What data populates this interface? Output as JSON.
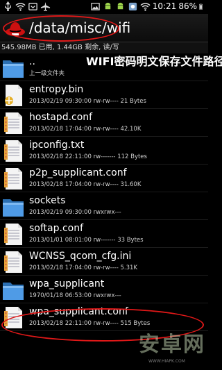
{
  "status_bar": {
    "time": "10:21",
    "battery": "86%",
    "icons_left": [
      "usb-icon",
      "wifi-icon",
      "tray-icon",
      "airplane-icon"
    ],
    "icons_right": [
      "image-icon",
      "android-icon",
      "android-icon",
      "settings-icon",
      "wifi-signal-icon",
      "battery-icon"
    ]
  },
  "path_bar": {
    "path": "/data/misc/wifi",
    "icon": "redhat-icon"
  },
  "storage_info": "545.98MB 已用, 1.44GB 剩余, 读/写",
  "overlay_title": "WIFI密码明文保存文件路径",
  "files": [
    {
      "name": "..",
      "meta": "上一级文件夹",
      "icon": "folder-icon",
      "type": "folder"
    },
    {
      "name": "entropy.bin",
      "meta": "2013/02/19 09:30:00  rw-rw----   21 Bytes",
      "icon": "binary-file-icon",
      "type": "binary"
    },
    {
      "name": "hostapd.conf",
      "meta": "2013/02/18 17:04:00  rw-rw----  42.10K",
      "icon": "text-file-icon",
      "type": "text"
    },
    {
      "name": "ipconfig.txt",
      "meta": "2013/02/18 22:11:00  rw-------  112 Bytes",
      "icon": "text-file-icon",
      "type": "text"
    },
    {
      "name": "p2p_supplicant.conf",
      "meta": "2013/02/18 17:04:00  rw-rw----  31.60K",
      "icon": "text-file-icon",
      "type": "text"
    },
    {
      "name": "sockets",
      "meta": "2013/02/19 09:30:00  rwxrwx---",
      "icon": "folder-icon",
      "type": "folder"
    },
    {
      "name": "softap.conf",
      "meta": "2013/01/01 08:01:00  rw-------  33 Bytes",
      "icon": "text-file-icon",
      "type": "text"
    },
    {
      "name": "WCNSS_qcom_cfg.ini",
      "meta": "2013/02/18 17:04:00  rw-rw----  5.31K",
      "icon": "text-file-icon",
      "type": "text"
    },
    {
      "name": "wpa_supplicant",
      "meta": "1970/01/18 06:53:00  rwxrwx---",
      "icon": "folder-icon",
      "type": "folder"
    },
    {
      "name": "wpa_supplicant.conf",
      "meta": "2013/02/18 22:11:00  rw-rw----  515 Bytes",
      "icon": "text-file-icon",
      "type": "text"
    }
  ],
  "watermark": {
    "text": "安卓网",
    "sub": "WWW.HIAPK.COM",
    "sub2": "安卓网 www.hiapk.com"
  },
  "colors": {
    "highlight_ring": "#e01818",
    "folder": "#3f8fd8",
    "background": "#000000"
  }
}
